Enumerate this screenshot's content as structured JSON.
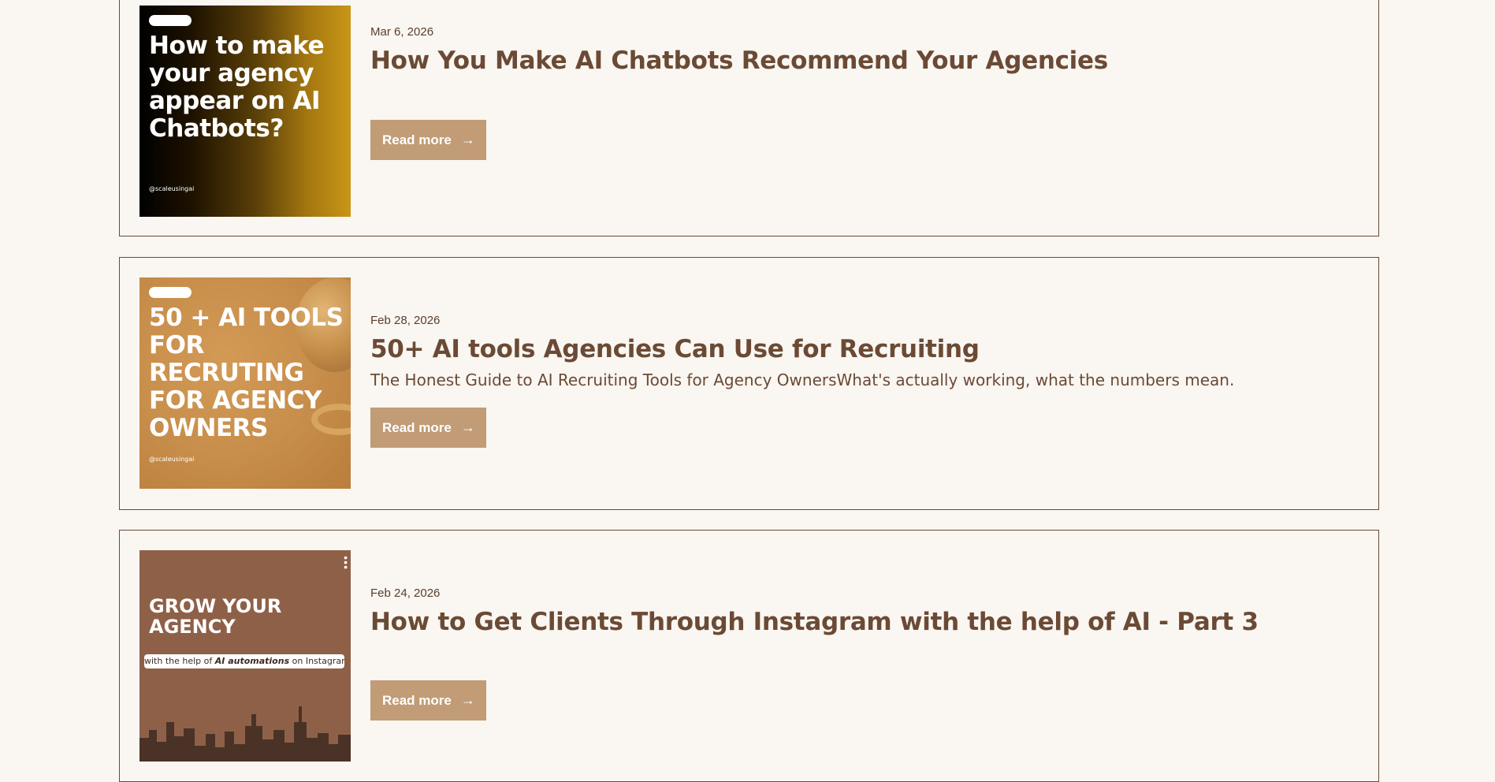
{
  "posts": [
    {
      "date": "Mar 6, 2026",
      "title": "How You Make AI Chatbots Recommend Your Agencies",
      "description": "",
      "read_more": "Read more",
      "thumb_text": "How to make your agency appear on AI Chatbots?",
      "thumb_handle": "@scaleusingai"
    },
    {
      "date": "Feb 28, 2026",
      "title": "50+ AI tools Agencies Can Use for Recruiting",
      "description": "The Honest Guide to AI Recruiting Tools for Agency OwnersWhat's actually working, what the numbers mean.",
      "read_more": "Read more",
      "thumb_text": "50 + AI TOOLS FOR RECRUTING FOR AGENCY OWNERS",
      "thumb_handle": "@scaleusingai"
    },
    {
      "date": "Feb 24, 2026",
      "title": "How to Get Clients Through Instagram with the help of AI - Part 3",
      "description": "",
      "read_more": "Read more",
      "thumb_text": "GROW YOUR AGENCY",
      "thumb_sub_prefix": "with the help of ",
      "thumb_sub_bold": "AI automations",
      "thumb_sub_suffix": " on Instagram"
    }
  ],
  "icons": {
    "arrow": "arrow-right-icon"
  },
  "colors": {
    "accent": "#6b4a35",
    "button": "#c19c76",
    "background": "#faf6f1"
  }
}
